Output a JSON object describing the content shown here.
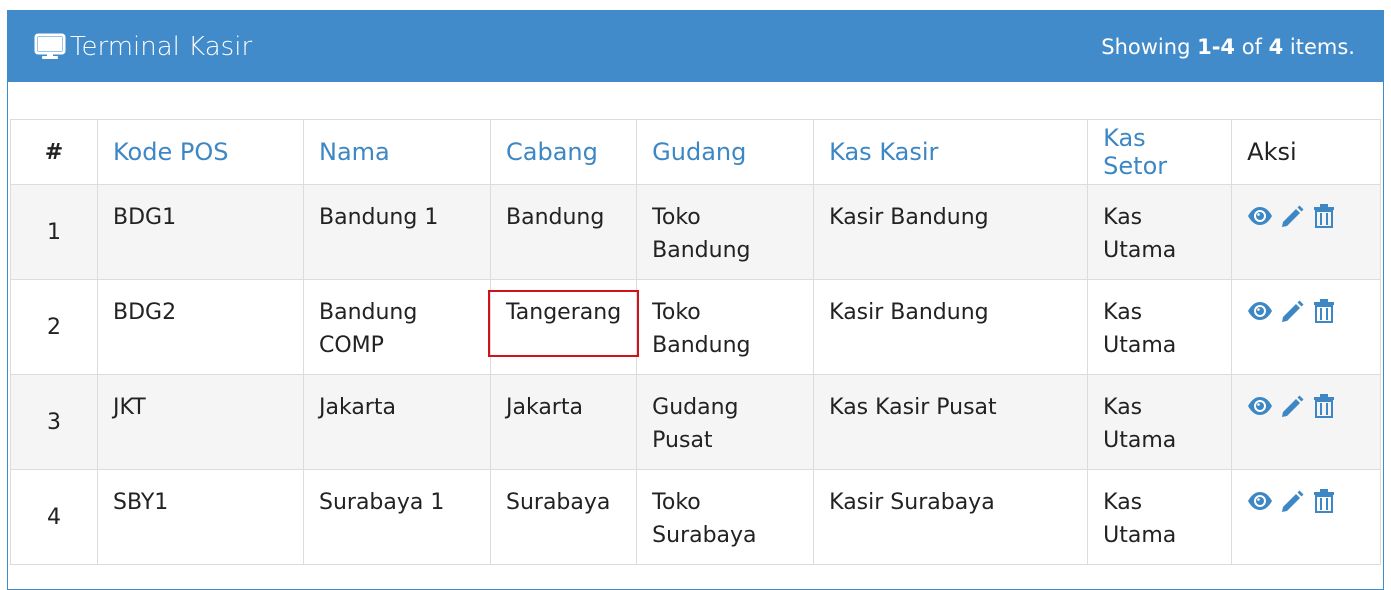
{
  "header": {
    "title": "Terminal Kasir",
    "summary_prefix": "Showing ",
    "summary_range": "1-4",
    "summary_mid": " of ",
    "summary_total": "4",
    "summary_suffix": " items."
  },
  "columns": [
    "#",
    "Kode POS",
    "Nama",
    "Cabang",
    "Gudang",
    "Kas Kasir",
    "Kas Setor",
    "Aksi"
  ],
  "rows": [
    {
      "num": "1",
      "kode": "BDG1",
      "nama": "Bandung 1",
      "cabang": "Bandung",
      "gudang": "Toko Bandung",
      "kas_kasir": "Kasir Bandung",
      "kas_setor": "Kas Utama"
    },
    {
      "num": "2",
      "kode": "BDG2",
      "nama": "Bandung COMP",
      "cabang": "Tangerang",
      "gudang": "Toko Bandung",
      "kas_kasir": "Kasir Bandung",
      "kas_setor": "Kas Utama"
    },
    {
      "num": "3",
      "kode": "JKT",
      "nama": "Jakarta",
      "cabang": "Jakarta",
      "gudang": "Gudang Pusat",
      "kas_kasir": "Kas Kasir Pusat",
      "kas_setor": "Kas Utama"
    },
    {
      "num": "4",
      "kode": "SBY1",
      "nama": "Surabaya 1",
      "cabang": "Surabaya",
      "gudang": "Toko Surabaya",
      "kas_kasir": "Kasir Surabaya",
      "kas_setor": "Kas Utama"
    }
  ],
  "icons": {
    "view": "eye-icon",
    "edit": "pencil-icon",
    "delete": "trash-icon",
    "title": "monitor-icon"
  },
  "colors": {
    "header_bg": "#428bca",
    "link": "#3c87c4",
    "highlight": "#d2121a"
  }
}
